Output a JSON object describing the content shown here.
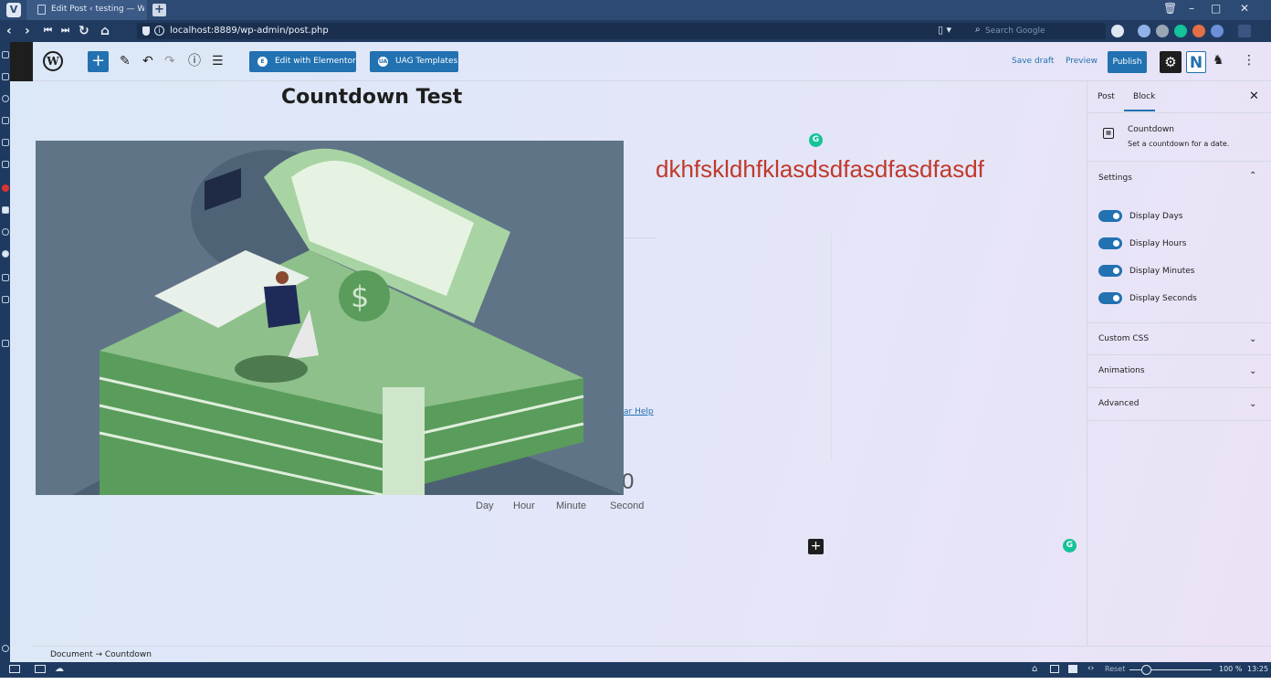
{
  "browser": {
    "tab_title": "Edit Post ‹ testing — Word",
    "url": "localhost:8889/wp-admin/post.php",
    "search_placeholder": "Search Google",
    "status": {
      "reset_label": "Reset",
      "zoom": "100 %",
      "time": "13:25"
    }
  },
  "toolbar": {
    "elementor_label": "Edit with Elementor",
    "uag_label": "UAG Templates",
    "save_draft": "Save draft",
    "preview": "Preview",
    "publish": "Publish",
    "n_label": "N"
  },
  "canvas": {
    "post_title": "Countdown Test",
    "red_text": "dkhfskldhfklasdsdfasdfasdfasdf",
    "help_link": "ar Help",
    "digit": "0",
    "countdown_labels": [
      "Day",
      "Hour",
      "Minute",
      "Second"
    ]
  },
  "sidebar": {
    "tabs": [
      "Post",
      "Block"
    ],
    "block_name": "Countdown",
    "block_desc": "Set a countdown for a date.",
    "settings_title": "Settings",
    "toggles": [
      "Display Days",
      "Display Hours",
      "Display Minutes",
      "Display Seconds"
    ],
    "panels": [
      "Custom CSS",
      "Animations",
      "Advanced"
    ]
  },
  "footer": {
    "breadcrumb": "Document → Countdown"
  },
  "colors": {
    "accent": "#2271b1",
    "red_text": "#c0392b",
    "grammarly": "#15c39a",
    "chrome": "#213b60"
  }
}
